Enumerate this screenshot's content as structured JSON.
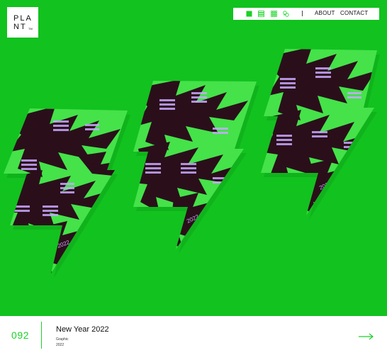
{
  "brand": {
    "logo_line1": "PLA",
    "logo_line2": "NT",
    "logo_tm": "TM"
  },
  "nav": {
    "view_icons": [
      "single-view-icon",
      "list-view-icon",
      "grid-view-icon",
      "related-view-icon"
    ],
    "links": [
      {
        "label": "ABOUT"
      },
      {
        "label": "CONTACT"
      }
    ]
  },
  "project": {
    "number": "092",
    "title": "New Year 2022",
    "category": "Graphic",
    "year": "2022"
  },
  "colors": {
    "accent": "#19d226",
    "hero_background": "#12c21f",
    "card_green": "#45e24a",
    "card_burst": "#2a0f1a",
    "calendar_text": "#c9a8ff"
  }
}
